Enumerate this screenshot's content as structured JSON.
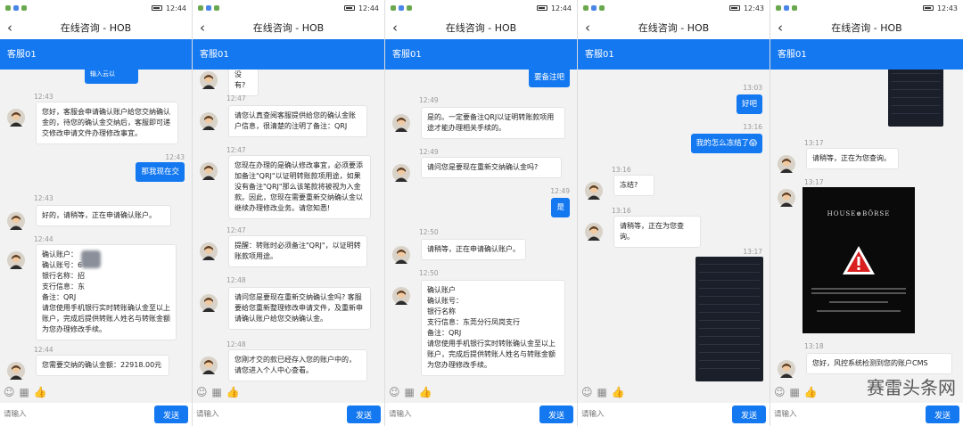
{
  "status": {
    "time_1": "12:44",
    "time_2": "12:44",
    "time_3": "12:44",
    "time_4": "12:43",
    "time_5": "12:43"
  },
  "header": {
    "title": "在线咨询 - HOB",
    "service": "客服01"
  },
  "composer": {
    "placeholder": "请输入",
    "send": "发送"
  },
  "watermark": "赛雷头条网",
  "screen1": {
    "top_partial": "输入云以",
    "ts1": "12:43",
    "m1": "您好，客服会申请确认账户给您交纳确认金的，待您的确认金交纳后，客服即可递交修改申请文件办理修改事宜。",
    "ts2": "12:43",
    "u1": "那我现在交",
    "ts3": "12:43",
    "m2": "好的，请稍等，正在申请确认账户。",
    "ts4": "12:44",
    "m3_lines": [
      "确认账户：",
      "确认账号：6",
      "银行名称：招",
      "支行信息：东",
      "备注：QRJ",
      "请您使用手机银行实时转账确认金至以上账户，完成后提供转账人姓名与转账金额为您办理修改手续。"
    ],
    "ts5": "12:44",
    "m4": "您需要交纳的确认金额：22918.00元"
  },
  "screen2": {
    "top_partial": "没有?",
    "ts1": "12:47",
    "m1": "请您认真查阅客服提供给您的确认金账户信息，很清楚的注明了备注：QRJ",
    "ts2": "12:47",
    "m2": "您现在办理的是确认修改事宜，必须要添加备注\"QRJ\"以证明转账款项用途，如果没有备注\"QRJ\"那么该笔款将被视为入金款。因此，您现在需要重新交纳确认金以继续办理修改业务。请您知悉!",
    "ts3": "12:47",
    "m3": "提醒：转账时必须备注\"QRJ\"，以证明转账款项用途。",
    "ts4": "12:48",
    "m4": "请问您是要现在重新交纳确认金吗? 客服要给您重新整理修改申请文件，及重新申请确认账户给您交纳确认金。",
    "ts5": "12:48",
    "m5": "您刚才交的款已经存入您的账户中的，请您进入个人中心查看。"
  },
  "screen3": {
    "top_user": "要备注吧",
    "ts1": "12:49",
    "m1": "是的。一定要备注QRJ以证明转账款项用途才能办理相关手续的。",
    "ts2": "12:49",
    "m2": "请问您是要现在重新交纳确认金吗?",
    "ts3": "12:49",
    "u1": "是",
    "ts4": "12:50",
    "m3": "请稍等，正在申请确认账户。",
    "ts5": "12:50",
    "m4_lines": [
      "确认账户",
      "确认账号：",
      "银行名称",
      "支行信息：东莞分行凤岗支行",
      "备注：QRJ",
      "请您使用手机银行实时转账确认金至以上账户，完成后提供转账人姓名与转账金额为您办理修改手续。"
    ]
  },
  "screen4": {
    "ts1": "13:03",
    "u1": "好吧",
    "ts2": "13:16",
    "u2": "我的怎么冻结了😱",
    "ts3": "13:16",
    "m1": "冻结?",
    "ts4": "13:16",
    "m2": "请稍等，正在为您查询。",
    "ts5": "13:17"
  },
  "screen5": {
    "ts1": "13:17",
    "m1": "请稍等，正在为您查询。",
    "ts2": "13:17",
    "brand": "HOUSE⊕BÖRSE",
    "ts3": "13:18",
    "m2": "您好，风控系统检测到您的账户CMS"
  }
}
